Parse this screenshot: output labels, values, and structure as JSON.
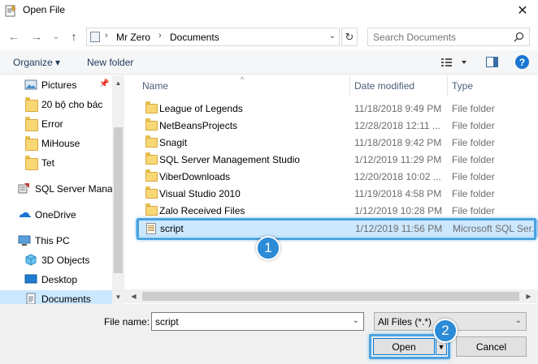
{
  "window": {
    "title": "Open File",
    "close_glyph": "✕"
  },
  "nav": {
    "back": "←",
    "forward": "→",
    "recent": "⌄",
    "up": "↑"
  },
  "address": {
    "crumbs": [
      "Mr Zero",
      "Documents"
    ],
    "separator": "›",
    "refresh": "↻"
  },
  "search": {
    "placeholder": "Search Documents"
  },
  "toolbar": {
    "organize": "Organize ▾",
    "new_folder": "New folder",
    "help": "?"
  },
  "navpane": {
    "items": [
      {
        "label": "Pictures",
        "icon": "pictures-icon",
        "pinned": true
      },
      {
        "label": "20 bộ cho bác",
        "icon": "folder-icon"
      },
      {
        "label": "Error",
        "icon": "folder-icon"
      },
      {
        "label": "MiHouse",
        "icon": "folder-icon"
      },
      {
        "label": "Tet",
        "icon": "folder-icon"
      },
      {
        "label": "SQL Server Manag",
        "icon": "sql-server-icon"
      },
      {
        "label": "OneDrive",
        "icon": "onedrive-icon"
      },
      {
        "label": "This PC",
        "icon": "this-pc-icon"
      },
      {
        "label": "3D Objects",
        "icon": "3d-objects-icon"
      },
      {
        "label": "Desktop",
        "icon": "desktop-icon"
      },
      {
        "label": "Documents",
        "icon": "documents-icon",
        "selected": true
      }
    ]
  },
  "columns": {
    "name": "Name",
    "date": "Date modified",
    "type": "Type"
  },
  "files": [
    {
      "name": "League of Legends",
      "date": "11/18/2018 9:49 PM",
      "type": "File folder"
    },
    {
      "name": "NetBeansProjects",
      "date": "12/28/2018 12:11 ...",
      "type": "File folder"
    },
    {
      "name": "Snagit",
      "date": "11/18/2018 9:42 PM",
      "type": "File folder"
    },
    {
      "name": "SQL Server Management Studio",
      "date": "1/12/2019 11:29 PM",
      "type": "File folder"
    },
    {
      "name": "ViberDownloads",
      "date": "12/20/2018 10:02 ...",
      "type": "File folder"
    },
    {
      "name": "Visual Studio 2010",
      "date": "11/19/2018 4:58 PM",
      "type": "File folder"
    },
    {
      "name": "Zalo Received Files",
      "date": "1/12/2019 10:28 PM",
      "type": "File folder"
    },
    {
      "name": "script",
      "date": "1/12/2019 11:56 PM",
      "type": "Microsoft SQL Ser...",
      "selected": true
    }
  ],
  "bottom": {
    "filename_label": "File name:",
    "filename_value": "script",
    "filter_value": "All Files (*.*)",
    "open_label": "Open",
    "cancel_label": "Cancel"
  },
  "annotations": {
    "step1": "1",
    "step2": "2"
  },
  "colors": {
    "accent": "#0078d7",
    "highlight": "#4aa3df",
    "selection": "#cce8ff",
    "badge": "#2b8bd6"
  }
}
